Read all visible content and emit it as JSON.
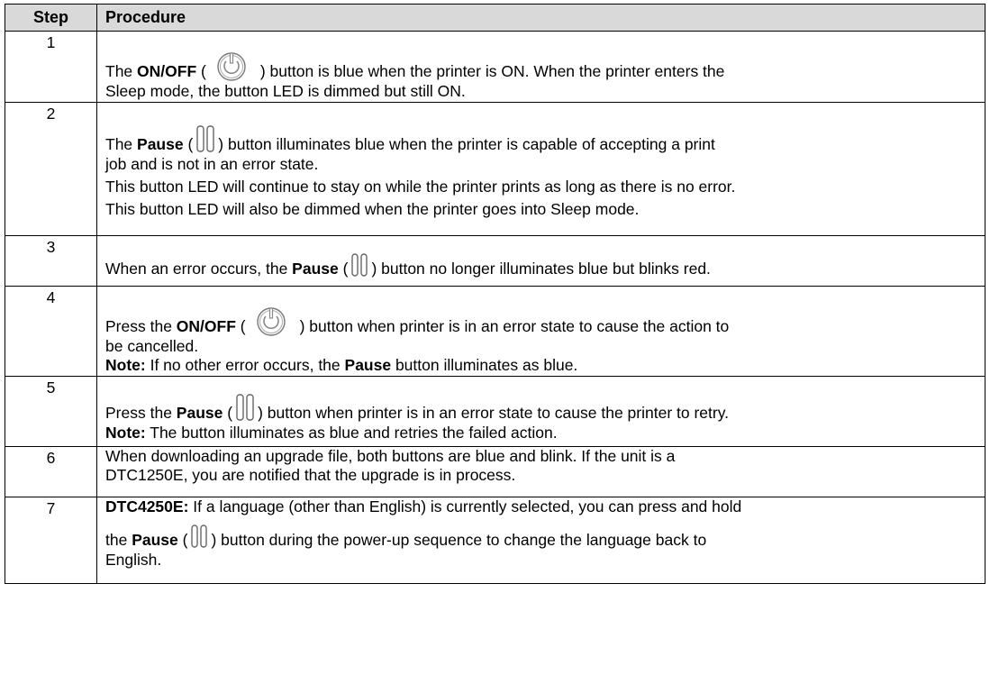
{
  "table": {
    "headers": {
      "step": "Step",
      "procedure": "Procedure"
    },
    "rows": [
      {
        "step": "1",
        "a_pre": "The ",
        "a_bold": "ON/OFF",
        "a_open": "  (",
        "a_post": ")  button is blue when the printer is ON. When the printer enters the",
        "b": "Sleep mode, the button LED is dimmed but still ON."
      },
      {
        "step": "2",
        "a_pre": "The ",
        "a_bold": "Pause",
        "a_open": " (",
        "a_post": ") button illuminates blue when the printer is capable of accepting a print",
        "b": "job and is not in an error state.",
        "c": "This button LED will continue to stay on while the printer prints as long as there is no error.",
        "d": "This button LED will also be dimmed when the printer goes into Sleep mode."
      },
      {
        "step": "3",
        "a_pre": "When an error occurs, the ",
        "a_bold": "Pause",
        "a_open": " (",
        "a_post": ") button no longer illuminates blue but  blinks red."
      },
      {
        "step": "4",
        "a_pre": "Press the ",
        "a_bold": "ON/OFF",
        "a_open": " (",
        "a_post": ") button when printer is in an error state to cause the action to",
        "b": "be cancelled.",
        "note_label": "Note:",
        "note_pre": " If no other error occurs, the ",
        "note_bold": "Pause",
        "note_post": " button illuminates as blue."
      },
      {
        "step": "5",
        "a_pre": "Press the ",
        "a_bold": "Pause",
        "a_open": " (",
        "a_post": ") button when printer is in an error state to cause the printer to retry.",
        "note_label": "Note:",
        "note_text": " The button illuminates as blue and retries the failed action."
      },
      {
        "step": "6",
        "a": "When downloading an upgrade file, both buttons are blue and blink. If the unit is a",
        "b": "DTC1250E, you are notified that the upgrade is in process."
      },
      {
        "step": "7",
        "a_bold": "DTC4250E:",
        "a_post": " If a language (other than English) is currently selected, you can press and hold",
        "b_pre": "the ",
        "b_bold": "Pause",
        "b_open": " (",
        "b_post": ") button during the power-up sequence to change the language back to",
        "c": "English."
      }
    ]
  },
  "icons": {
    "power": "power-icon",
    "pause": "pause-icon"
  }
}
